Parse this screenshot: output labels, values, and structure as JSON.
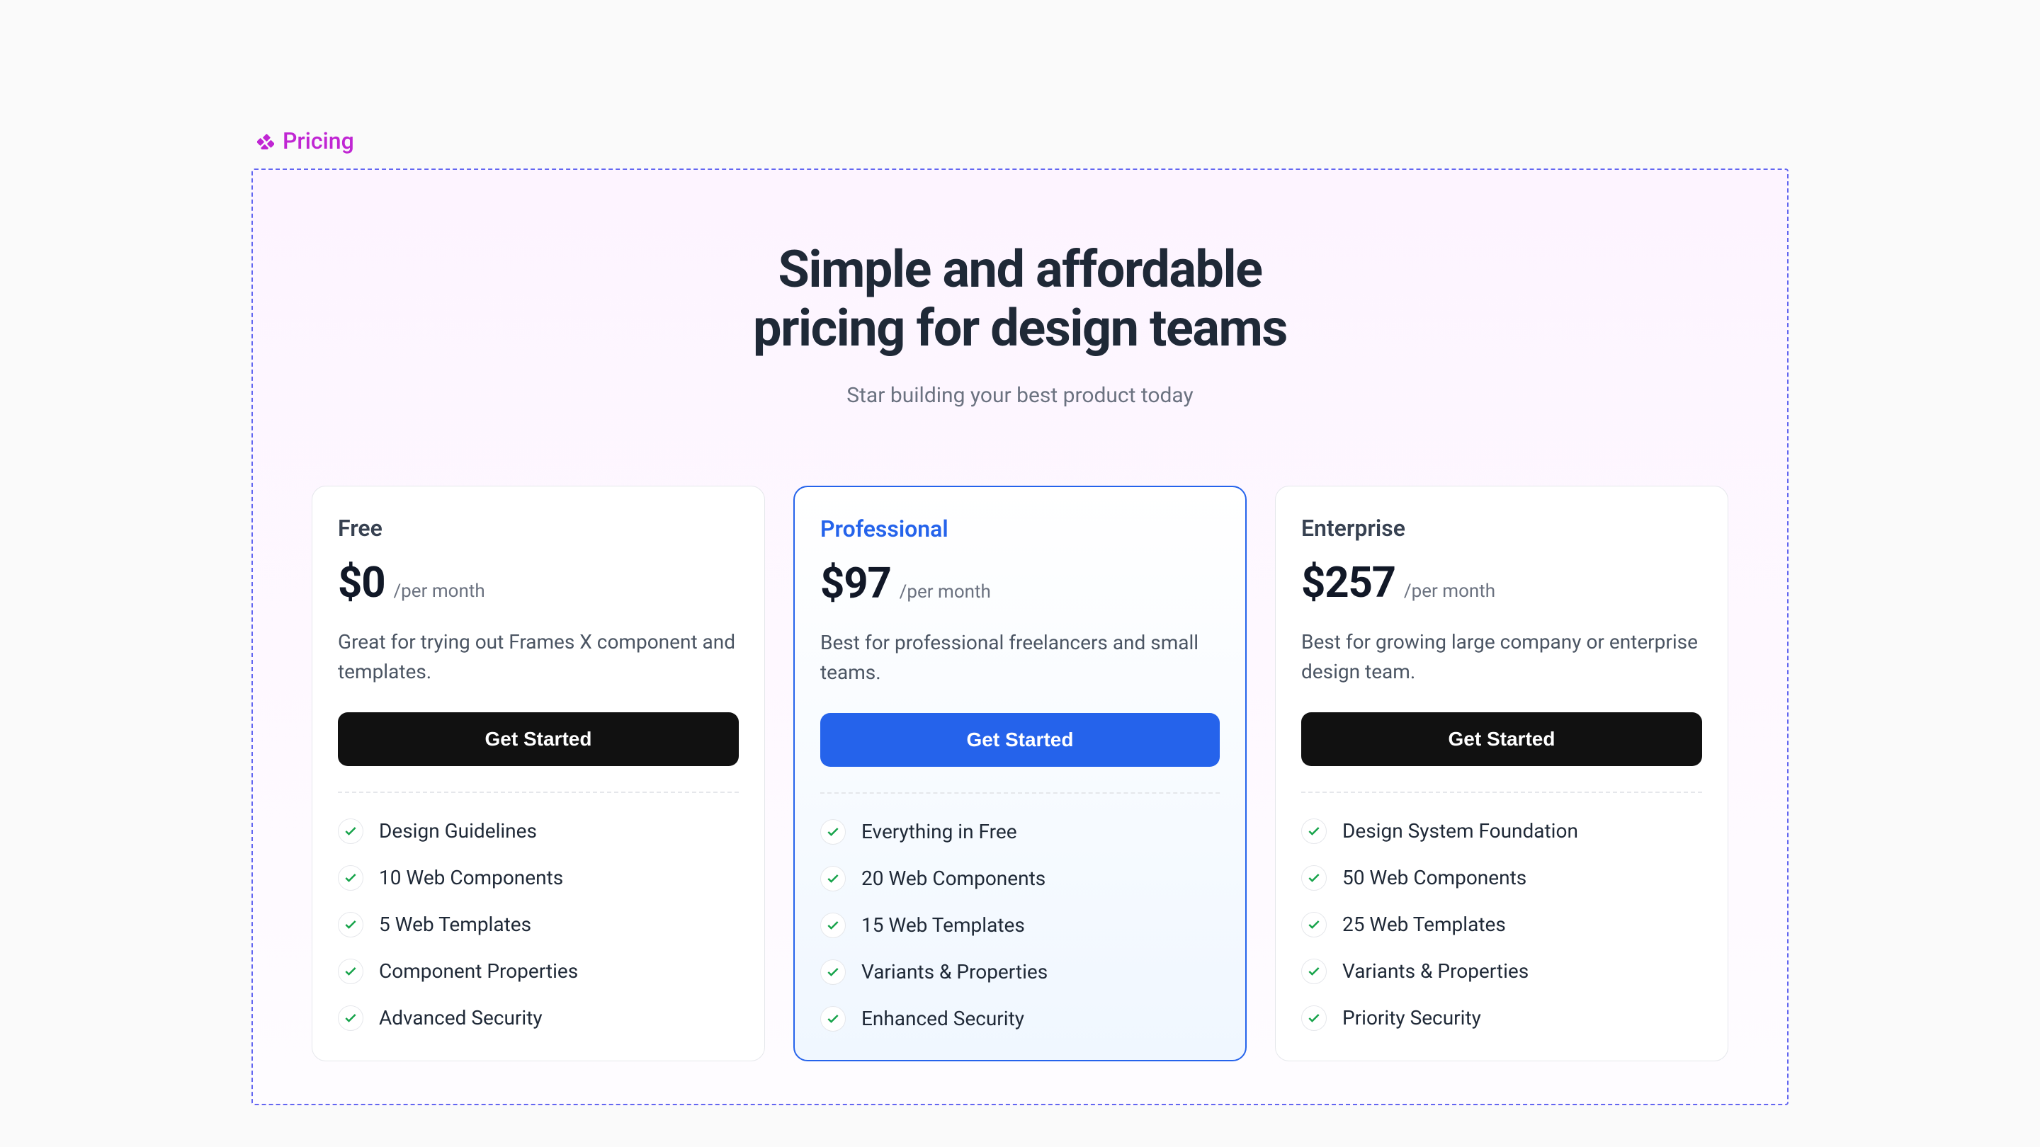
{
  "section": {
    "label": "Pricing"
  },
  "header": {
    "title_line1": "Simple and affordable",
    "title_line2": "pricing for design teams",
    "subtitle": "Star building your best product today"
  },
  "plans": [
    {
      "name": "Free",
      "price": "$0",
      "period": "/per month",
      "description": "Great for trying out Frames X component and templates.",
      "cta": "Get Started",
      "featured": false,
      "features": [
        "Design Guidelines",
        "10 Web Components",
        "5 Web Templates",
        "Component Properties",
        "Advanced Security"
      ]
    },
    {
      "name": "Professional",
      "price": "$97",
      "period": "/per month",
      "description": "Best for professional freelancers and small teams.",
      "cta": "Get Started",
      "featured": true,
      "features": [
        "Everything in Free",
        "20 Web Components",
        "15 Web Templates",
        "Variants & Properties",
        "Enhanced Security"
      ]
    },
    {
      "name": "Enterprise",
      "price": "$257",
      "period": "/per month",
      "description": "Best for growing large company or enterprise design team.",
      "cta": "Get Started",
      "featured": false,
      "features": [
        "Design System Foundation",
        "50 Web Components",
        "25 Web Templates",
        "Variants & Properties",
        "Priority Security"
      ]
    }
  ]
}
